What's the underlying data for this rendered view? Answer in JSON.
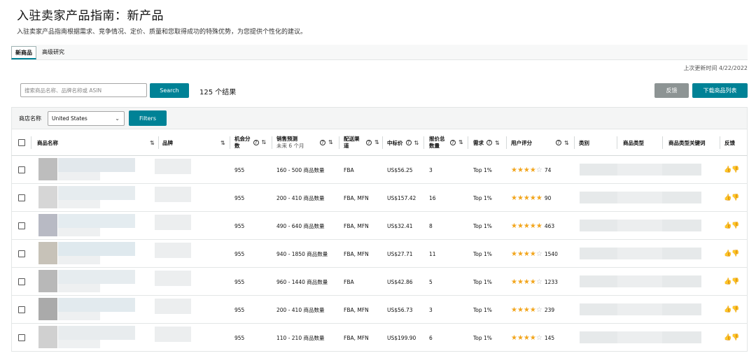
{
  "header": {
    "title": "入驻卖家产品指南：新产品",
    "subtitle": "入驻卖家产品指南根据需求、竞争情况、定价、质量和您取得成功的特殊优势，为您提供个性化的建议。"
  },
  "tabs": [
    {
      "label": "新商品",
      "active": true
    },
    {
      "label": "高级研究",
      "active": false
    }
  ],
  "last_updated": "上次更新时间 4/22/2022",
  "search": {
    "placeholder": "搜索商品名称、品牌名称或 ASIN",
    "value": "",
    "button": "Search",
    "result_count": "125 个结果"
  },
  "actions": {
    "feedback": "反馈",
    "download": "下载商品列表"
  },
  "filter_bar": {
    "store_label": "商店名称",
    "store_value": "United States",
    "filters_button": "Filters"
  },
  "table": {
    "columns": {
      "product": "商品名称",
      "brand": "品牌",
      "score_l1": "机会分",
      "score_l2": "数",
      "sales_l1": "销售预测",
      "sales_l2": "未来 6 个月",
      "channel_l1": "配送渠",
      "channel_l2": "道",
      "median_price": "中标价",
      "offers_l1": "报价总",
      "offers_l2": "数量",
      "demand": "需求",
      "rating": "用户评分",
      "category": "类别",
      "product_type": "商品类型",
      "keywords": "商品类型关键词",
      "feedback": "反馈"
    },
    "rows": [
      {
        "score": "955",
        "sales": "160 - 500 商品数量",
        "channel": "FBA",
        "price": "US$56.25",
        "offers": "3",
        "demand": "Top 1%",
        "stars": "★★★★",
        "empty": "☆",
        "reviews": "74"
      },
      {
        "score": "955",
        "sales": "200 - 410 商品数量",
        "channel": "FBA, MFN",
        "price": "US$157.42",
        "offers": "16",
        "demand": "Top 1%",
        "stars": "★★★★★",
        "empty": "",
        "reviews": "90"
      },
      {
        "score": "955",
        "sales": "490 - 640 商品数量",
        "channel": "FBA, MFN",
        "price": "US$32.41",
        "offers": "8",
        "demand": "Top 1%",
        "stars": "★★★★★",
        "empty": "",
        "reviews": "463"
      },
      {
        "score": "955",
        "sales": "940 - 1850 商品数量",
        "channel": "FBA, MFN",
        "price": "US$27.71",
        "offers": "11",
        "demand": "Top 1%",
        "stars": "★★★★",
        "empty": "☆",
        "reviews": "1540"
      },
      {
        "score": "955",
        "sales": "960 - 1440 商品数量",
        "channel": "FBA",
        "price": "US$42.86",
        "offers": "5",
        "demand": "Top 1%",
        "stars": "★★★★",
        "empty": "☆",
        "reviews": "1233"
      },
      {
        "score": "955",
        "sales": "200 - 410 商品数量",
        "channel": "FBA, MFN",
        "price": "US$56.73",
        "offers": "3",
        "demand": "Top 1%",
        "stars": "★★★★",
        "empty": "☆",
        "reviews": "239"
      },
      {
        "score": "955",
        "sales": "110 - 210 商品数量",
        "channel": "FBA, MFN",
        "price": "US$199.90",
        "offers": "6",
        "demand": "Top 1%",
        "stars": "★★★★",
        "empty": "☆",
        "reviews": "145"
      }
    ]
  },
  "icons": {
    "sort": "sort-arrows-icon",
    "info": "info-icon",
    "chevron": "chevron-down-icon",
    "thumbs": "thumbs-up-down-icon"
  },
  "colors": {
    "accent": "#008296",
    "star": "#f2a51c",
    "secondary_button": "#8d9494"
  }
}
